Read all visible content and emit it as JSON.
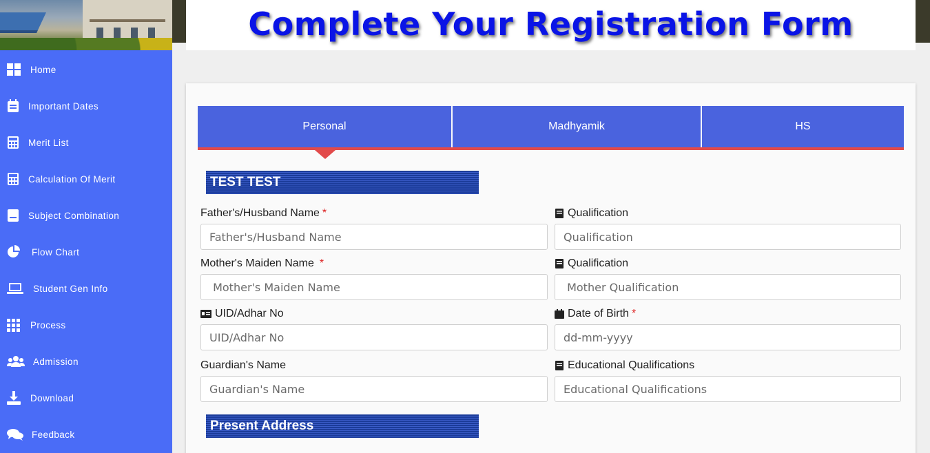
{
  "header": {
    "title": "Complete Your Registration Form"
  },
  "sidebar": {
    "items": [
      {
        "label": "Home",
        "icon": "grid-icon"
      },
      {
        "label": "Important Dates",
        "icon": "calendar-icon"
      },
      {
        "label": "Merit List",
        "icon": "calculator-icon"
      },
      {
        "label": "Calculation Of Merit",
        "icon": "calculator-icon"
      },
      {
        "label": "Subject Combination",
        "icon": "document-icon"
      },
      {
        "label": "Flow Chart",
        "icon": "pie-chart-icon"
      },
      {
        "label": "Student Gen Info",
        "icon": "laptop-icon"
      },
      {
        "label": "Process",
        "icon": "grid-icon"
      },
      {
        "label": "Admission",
        "icon": "users-icon"
      },
      {
        "label": "Download",
        "icon": "download-icon"
      },
      {
        "label": "Feedback",
        "icon": "comments-icon"
      }
    ]
  },
  "tabs": [
    {
      "label": "Personal"
    },
    {
      "label": "Madhyamik"
    },
    {
      "label": "HS"
    }
  ],
  "sections": {
    "personal": "TEST TEST",
    "address": "Present Address"
  },
  "form": {
    "father_label": "Father's/Husband Name",
    "father_placeholder": "Father's/Husband Name",
    "father_qual_label": "Qualification",
    "father_qual_placeholder": "Qualification",
    "mother_label": "Mother's Maiden Name",
    "mother_placeholder": " Mother's Maiden Name",
    "mother_qual_label": "Qualification",
    "mother_qual_placeholder": " Mother Qualification",
    "uid_label": "UID/Adhar No",
    "uid_placeholder": "UID/Adhar No",
    "dob_label": "Date of Birth",
    "dob_placeholder": "dd-mm-yyyy",
    "guardian_label": "Guardian's Name",
    "guardian_placeholder": "Guardian's Name",
    "edu_label": "Educational Qualifications",
    "edu_placeholder": "Educational Qualifications",
    "required_mark": "*"
  },
  "colors": {
    "sidebar": "#4a6cf7",
    "tab": "#4a63de",
    "tab_underline": "#e24a4a",
    "title": "#0a14e6",
    "required": "#dd2222"
  }
}
